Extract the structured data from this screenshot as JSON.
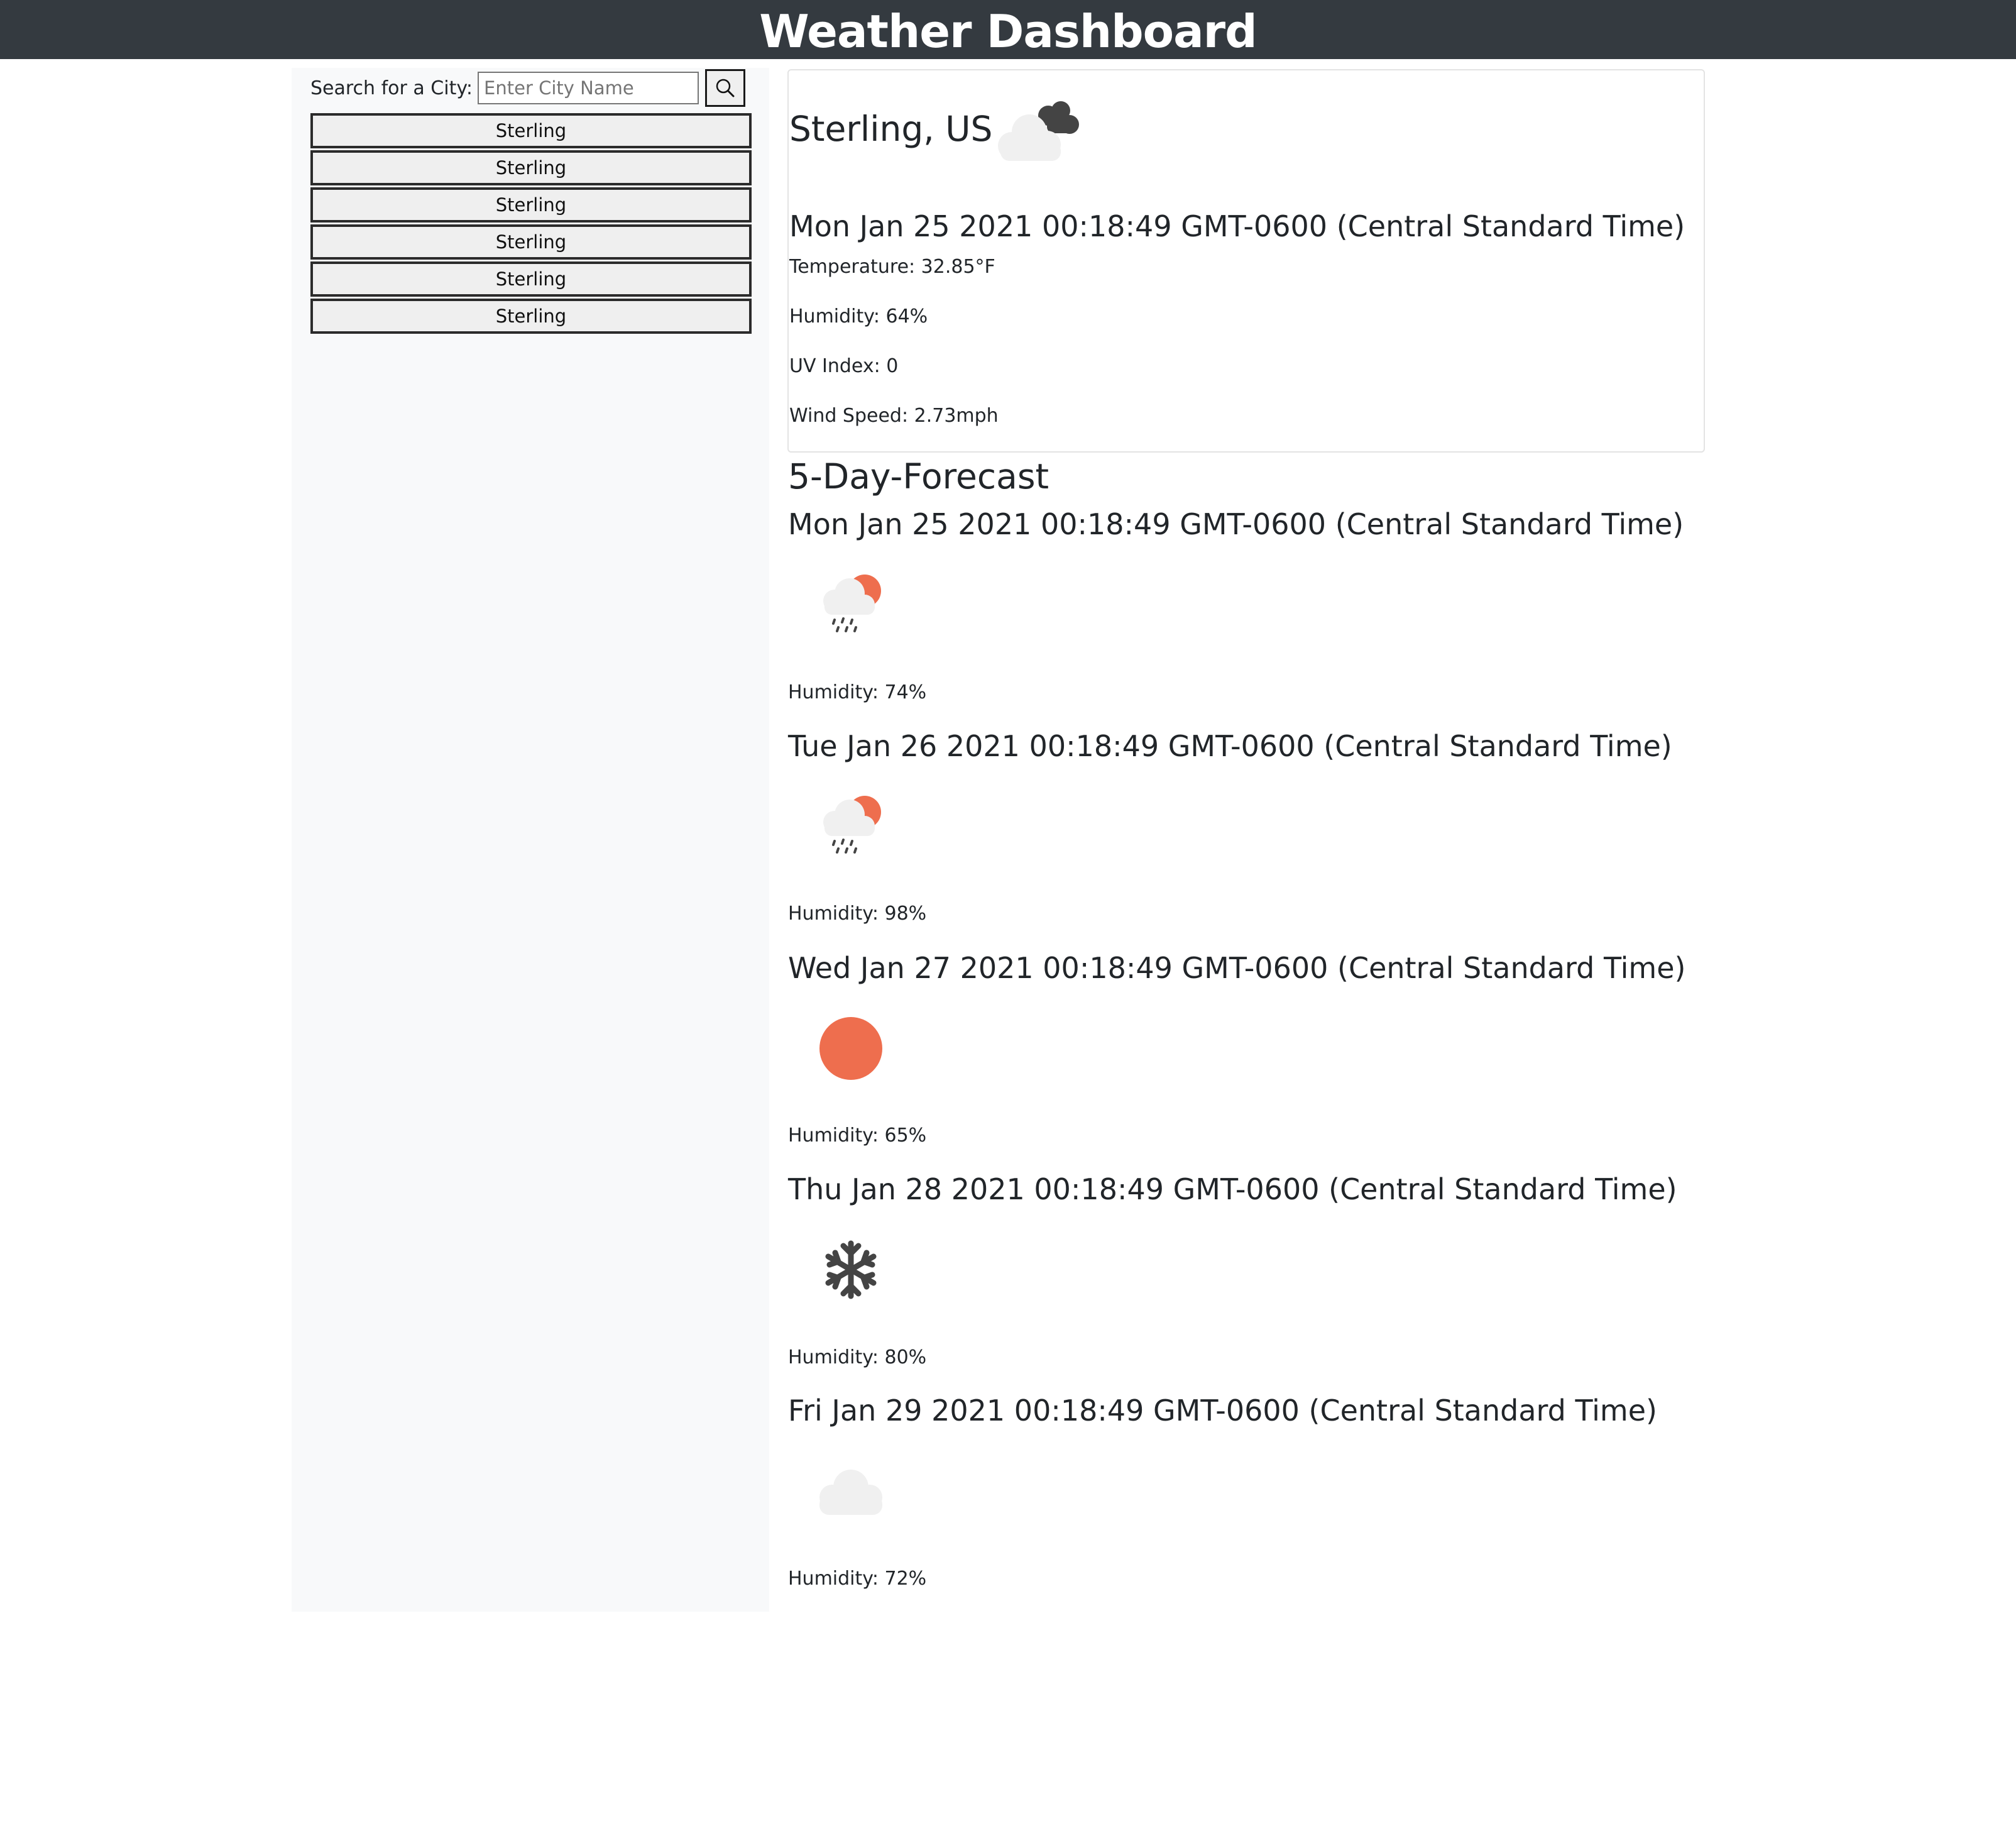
{
  "header": {
    "title": "Weather Dashboard"
  },
  "search": {
    "label": "Search for a City:",
    "placeholder": "Enter City Name",
    "button_icon": "search-icon"
  },
  "history": [
    "Sterling",
    "Sterling",
    "Sterling",
    "Sterling",
    "Sterling",
    "Sterling"
  ],
  "current": {
    "city": "Sterling, US",
    "icon": "cloudy-icon",
    "date": "Mon Jan 25 2021 00:18:49 GMT-0600 (Central Standard Time)",
    "temperature": "Temperature: 32.85°F",
    "humidity": "Humidity: 64%",
    "uv_index": "UV Index: 0",
    "wind_speed": "Wind Speed: 2.73mph"
  },
  "forecast": {
    "heading": "5-Day-Forecast",
    "days": [
      {
        "date": "Mon Jan 25 2021 00:18:49 GMT-0600 (Central Standard Time)",
        "icon": "rain-sun-icon",
        "humidity": "Humidity: 74%"
      },
      {
        "date": "Tue Jan 26 2021 00:18:49 GMT-0600 (Central Standard Time)",
        "icon": "rain-sun-icon",
        "humidity": "Humidity: 98%"
      },
      {
        "date": "Wed Jan 27 2021 00:18:49 GMT-0600 (Central Standard Time)",
        "icon": "sun-icon",
        "humidity": "Humidity: 65%"
      },
      {
        "date": "Thu Jan 28 2021 00:18:49 GMT-0600 (Central Standard Time)",
        "icon": "snow-icon",
        "humidity": "Humidity: 80%"
      },
      {
        "date": "Fri Jan 29 2021 00:18:49 GMT-0600 (Central Standard Time)",
        "icon": "cloud-icon",
        "humidity": "Humidity: 72%"
      }
    ]
  },
  "colors": {
    "header_bg": "#343a40",
    "sidebar_bg": "#f8f9fa",
    "sun": "#ee6e4e",
    "dark_cloud": "#444444",
    "light_cloud": "#f0f0f0"
  }
}
